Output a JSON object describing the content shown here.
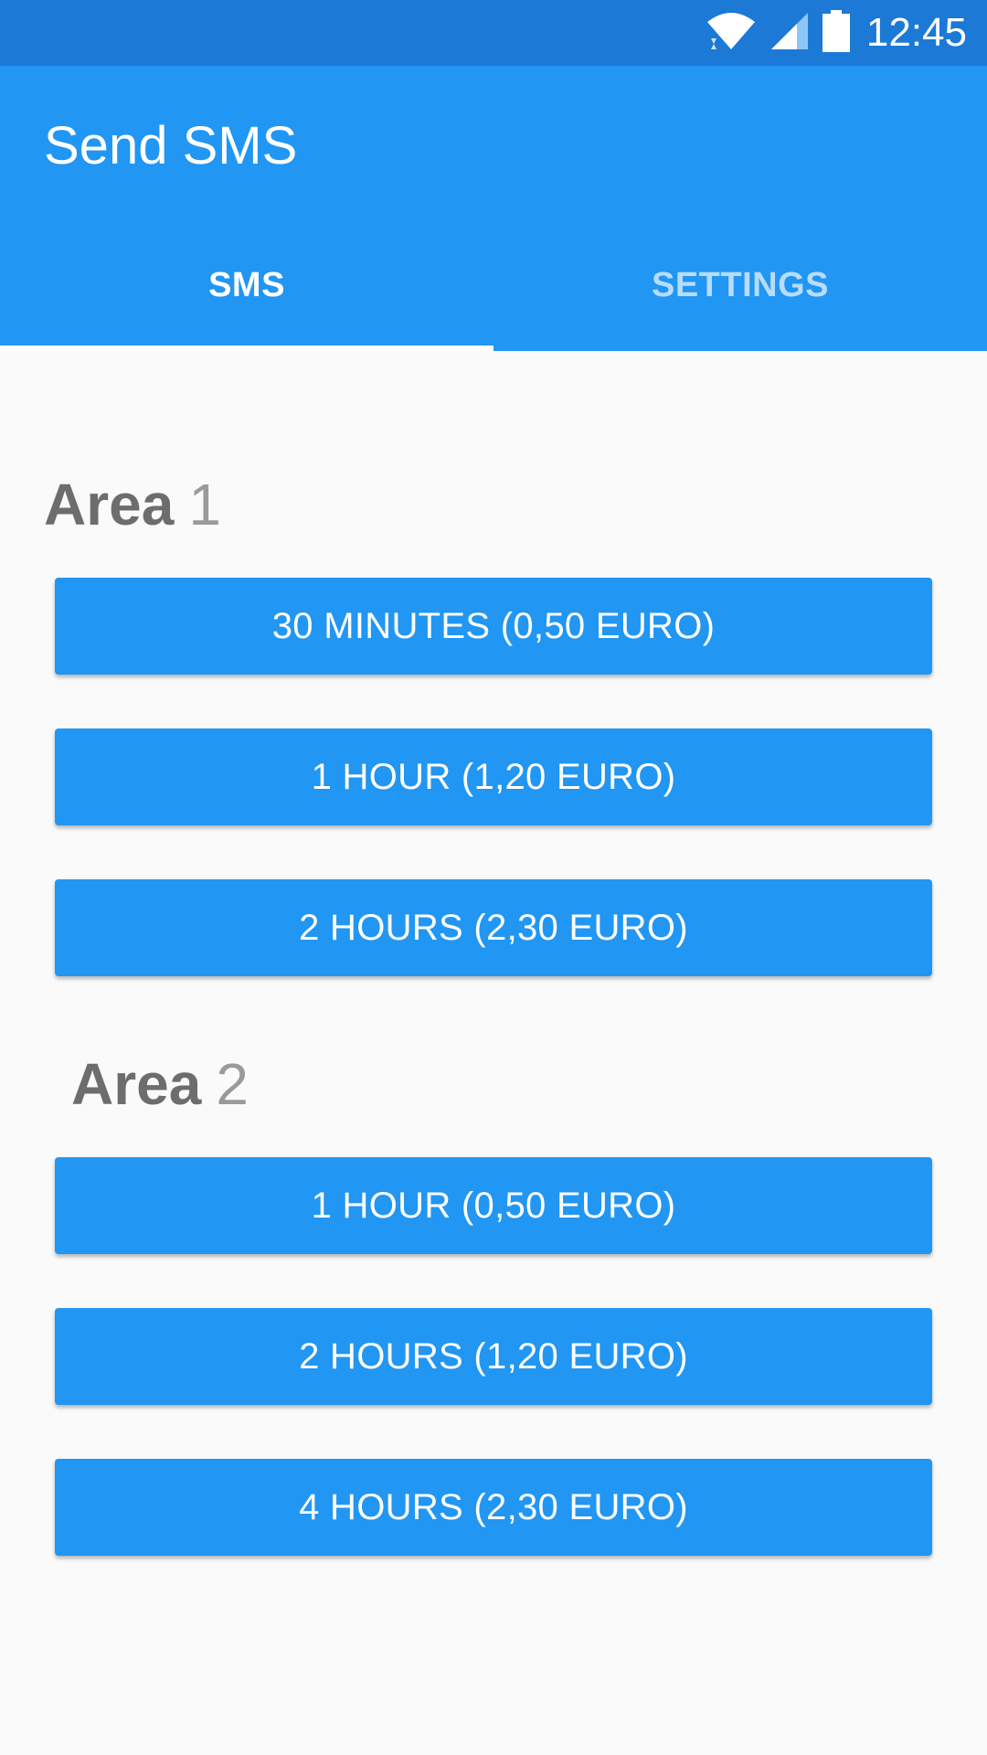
{
  "status_bar": {
    "time": "12:45",
    "icons": [
      "wifi-icon",
      "cell-signal-icon",
      "battery-icon"
    ]
  },
  "app_bar": {
    "title": "Send SMS",
    "tabs": [
      {
        "label": "SMS",
        "active": true
      },
      {
        "label": "SETTINGS",
        "active": false
      }
    ]
  },
  "areas": [
    {
      "word": "Area",
      "number": "1",
      "buttons": [
        "30 MINUTES (0,50 EURO)",
        "1 HOUR (1,20 EURO)",
        "2 HOURS (2,30 EURO)"
      ]
    },
    {
      "word": "Area",
      "number": "2",
      "buttons": [
        "1 HOUR (0,50 EURO)",
        "2 HOURS (1,20 EURO)",
        "4 HOURS (2,30 EURO)"
      ]
    }
  ],
  "colors": {
    "status_bar": "#1c79d6",
    "primary": "#2196f3",
    "background": "#fafafa",
    "heading_text": "#6d6d6d",
    "heading_number": "#9a9a9a",
    "tab_inactive": "#b8dcfb"
  }
}
